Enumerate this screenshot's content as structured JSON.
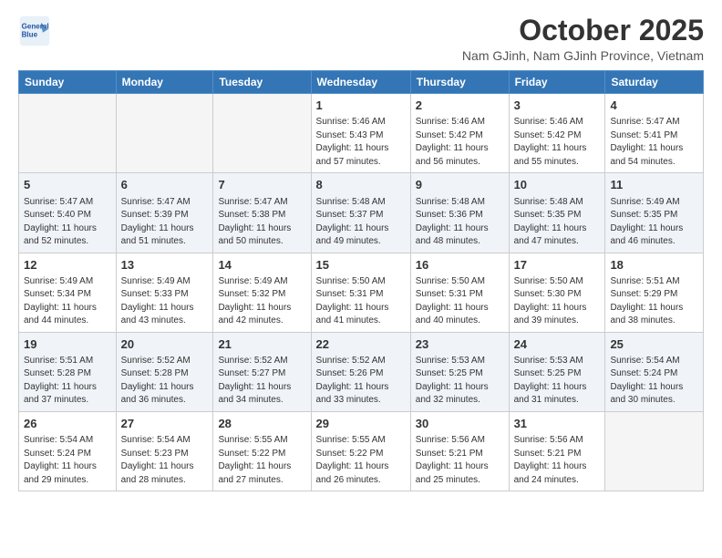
{
  "logo": {
    "line1": "General",
    "line2": "Blue"
  },
  "title": "October 2025",
  "subtitle": "Nam GJinh, Nam GJinh Province, Vietnam",
  "days_of_week": [
    "Sunday",
    "Monday",
    "Tuesday",
    "Wednesday",
    "Thursday",
    "Friday",
    "Saturday"
  ],
  "weeks": [
    {
      "shade": false,
      "days": [
        {
          "number": "",
          "info": ""
        },
        {
          "number": "",
          "info": ""
        },
        {
          "number": "",
          "info": ""
        },
        {
          "number": "1",
          "info": "Sunrise: 5:46 AM\nSunset: 5:43 PM\nDaylight: 11 hours\nand 57 minutes."
        },
        {
          "number": "2",
          "info": "Sunrise: 5:46 AM\nSunset: 5:42 PM\nDaylight: 11 hours\nand 56 minutes."
        },
        {
          "number": "3",
          "info": "Sunrise: 5:46 AM\nSunset: 5:42 PM\nDaylight: 11 hours\nand 55 minutes."
        },
        {
          "number": "4",
          "info": "Sunrise: 5:47 AM\nSunset: 5:41 PM\nDaylight: 11 hours\nand 54 minutes."
        }
      ]
    },
    {
      "shade": true,
      "days": [
        {
          "number": "5",
          "info": "Sunrise: 5:47 AM\nSunset: 5:40 PM\nDaylight: 11 hours\nand 52 minutes."
        },
        {
          "number": "6",
          "info": "Sunrise: 5:47 AM\nSunset: 5:39 PM\nDaylight: 11 hours\nand 51 minutes."
        },
        {
          "number": "7",
          "info": "Sunrise: 5:47 AM\nSunset: 5:38 PM\nDaylight: 11 hours\nand 50 minutes."
        },
        {
          "number": "8",
          "info": "Sunrise: 5:48 AM\nSunset: 5:37 PM\nDaylight: 11 hours\nand 49 minutes."
        },
        {
          "number": "9",
          "info": "Sunrise: 5:48 AM\nSunset: 5:36 PM\nDaylight: 11 hours\nand 48 minutes."
        },
        {
          "number": "10",
          "info": "Sunrise: 5:48 AM\nSunset: 5:35 PM\nDaylight: 11 hours\nand 47 minutes."
        },
        {
          "number": "11",
          "info": "Sunrise: 5:49 AM\nSunset: 5:35 PM\nDaylight: 11 hours\nand 46 minutes."
        }
      ]
    },
    {
      "shade": false,
      "days": [
        {
          "number": "12",
          "info": "Sunrise: 5:49 AM\nSunset: 5:34 PM\nDaylight: 11 hours\nand 44 minutes."
        },
        {
          "number": "13",
          "info": "Sunrise: 5:49 AM\nSunset: 5:33 PM\nDaylight: 11 hours\nand 43 minutes."
        },
        {
          "number": "14",
          "info": "Sunrise: 5:49 AM\nSunset: 5:32 PM\nDaylight: 11 hours\nand 42 minutes."
        },
        {
          "number": "15",
          "info": "Sunrise: 5:50 AM\nSunset: 5:31 PM\nDaylight: 11 hours\nand 41 minutes."
        },
        {
          "number": "16",
          "info": "Sunrise: 5:50 AM\nSunset: 5:31 PM\nDaylight: 11 hours\nand 40 minutes."
        },
        {
          "number": "17",
          "info": "Sunrise: 5:50 AM\nSunset: 5:30 PM\nDaylight: 11 hours\nand 39 minutes."
        },
        {
          "number": "18",
          "info": "Sunrise: 5:51 AM\nSunset: 5:29 PM\nDaylight: 11 hours\nand 38 minutes."
        }
      ]
    },
    {
      "shade": true,
      "days": [
        {
          "number": "19",
          "info": "Sunrise: 5:51 AM\nSunset: 5:28 PM\nDaylight: 11 hours\nand 37 minutes."
        },
        {
          "number": "20",
          "info": "Sunrise: 5:52 AM\nSunset: 5:28 PM\nDaylight: 11 hours\nand 36 minutes."
        },
        {
          "number": "21",
          "info": "Sunrise: 5:52 AM\nSunset: 5:27 PM\nDaylight: 11 hours\nand 34 minutes."
        },
        {
          "number": "22",
          "info": "Sunrise: 5:52 AM\nSunset: 5:26 PM\nDaylight: 11 hours\nand 33 minutes."
        },
        {
          "number": "23",
          "info": "Sunrise: 5:53 AM\nSunset: 5:25 PM\nDaylight: 11 hours\nand 32 minutes."
        },
        {
          "number": "24",
          "info": "Sunrise: 5:53 AM\nSunset: 5:25 PM\nDaylight: 11 hours\nand 31 minutes."
        },
        {
          "number": "25",
          "info": "Sunrise: 5:54 AM\nSunset: 5:24 PM\nDaylight: 11 hours\nand 30 minutes."
        }
      ]
    },
    {
      "shade": false,
      "days": [
        {
          "number": "26",
          "info": "Sunrise: 5:54 AM\nSunset: 5:24 PM\nDaylight: 11 hours\nand 29 minutes."
        },
        {
          "number": "27",
          "info": "Sunrise: 5:54 AM\nSunset: 5:23 PM\nDaylight: 11 hours\nand 28 minutes."
        },
        {
          "number": "28",
          "info": "Sunrise: 5:55 AM\nSunset: 5:22 PM\nDaylight: 11 hours\nand 27 minutes."
        },
        {
          "number": "29",
          "info": "Sunrise: 5:55 AM\nSunset: 5:22 PM\nDaylight: 11 hours\nand 26 minutes."
        },
        {
          "number": "30",
          "info": "Sunrise: 5:56 AM\nSunset: 5:21 PM\nDaylight: 11 hours\nand 25 minutes."
        },
        {
          "number": "31",
          "info": "Sunrise: 5:56 AM\nSunset: 5:21 PM\nDaylight: 11 hours\nand 24 minutes."
        },
        {
          "number": "",
          "info": ""
        }
      ]
    }
  ]
}
